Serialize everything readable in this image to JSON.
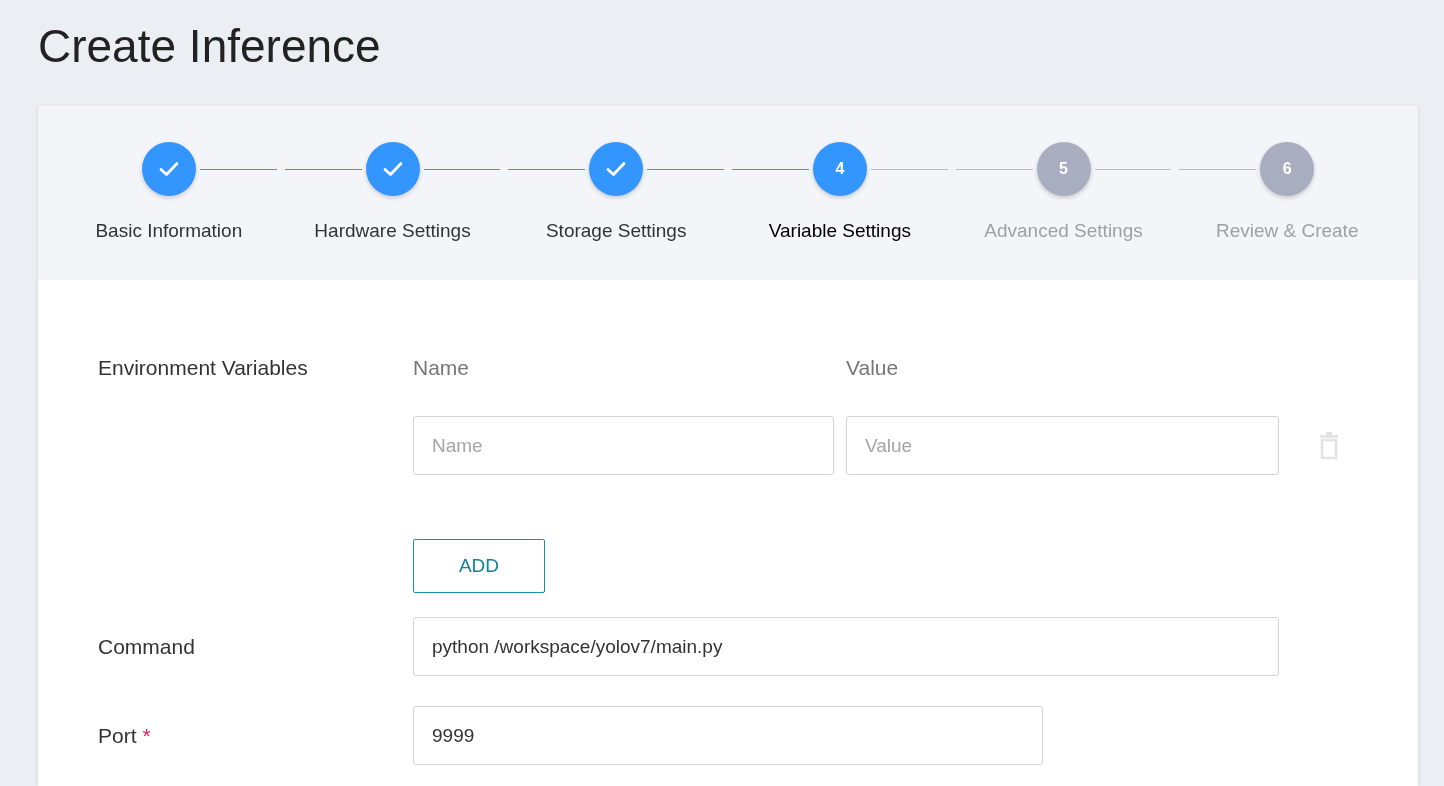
{
  "page_title": "Create Inference",
  "steps": [
    {
      "label": "Basic Information",
      "kind": "done"
    },
    {
      "label": "Hardware Settings",
      "kind": "done"
    },
    {
      "label": "Storage Settings",
      "kind": "done"
    },
    {
      "number": "4",
      "label": "Variable Settings",
      "kind": "active"
    },
    {
      "number": "5",
      "label": "Advanced Settings",
      "kind": "pending"
    },
    {
      "number": "6",
      "label": "Review & Create",
      "kind": "pending"
    }
  ],
  "env_vars": {
    "label": "Environment Variables",
    "name_header": "Name",
    "value_header": "Value",
    "rows": [
      {
        "name_placeholder": "Name",
        "value_placeholder": "Value"
      }
    ],
    "add_button": "ADD"
  },
  "command": {
    "label": "Command",
    "value": "python /workspace/yolov7/main.py"
  },
  "port": {
    "label": "Port",
    "value": "9999",
    "required_mark": "*"
  }
}
